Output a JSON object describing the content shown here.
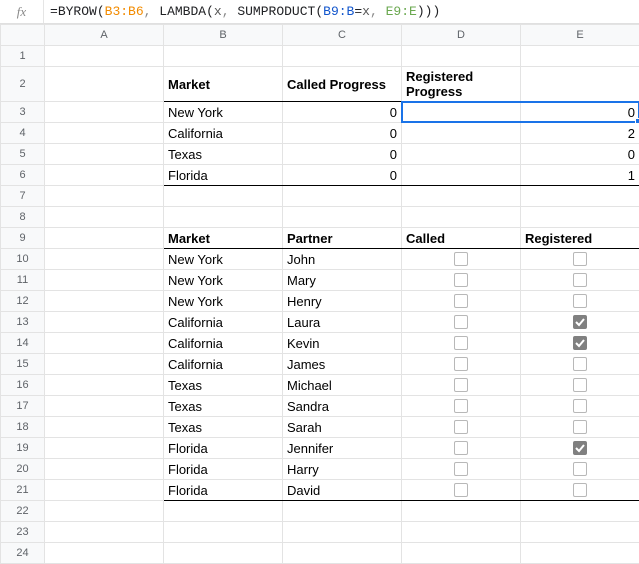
{
  "formula_bar": {
    "fx_label": "fx",
    "eq": "=",
    "fn_byrow": "BYROW",
    "lp": "(",
    "rp": ")",
    "ref_b3b6": "B3:B6",
    "comma": ", ",
    "fn_lambda": "LAMBDA",
    "var_x": "x",
    "fn_sumproduct": "SUMPRODUCT",
    "ref_b9b": "B9:B",
    "eqx": "=",
    "x2": "x",
    "ref_e9e": "E9:E"
  },
  "columns": [
    "A",
    "B",
    "C",
    "D",
    "E"
  ],
  "row_count": 24,
  "summary": {
    "header": {
      "market": "Market",
      "called": "Called Progress",
      "registered": "Registered Progress"
    },
    "rows": [
      {
        "market": "New York",
        "called": 0,
        "registered": 0
      },
      {
        "market": "California",
        "called": 0,
        "registered": 2
      },
      {
        "market": "Texas",
        "called": 0,
        "registered": 0
      },
      {
        "market": "Florida",
        "called": 0,
        "registered": 1
      }
    ]
  },
  "detail": {
    "header": {
      "market": "Market",
      "partner": "Partner",
      "called": "Called",
      "registered": "Registered"
    },
    "rows": [
      {
        "market": "New York",
        "partner": "John",
        "called": false,
        "registered": false
      },
      {
        "market": "New York",
        "partner": "Mary",
        "called": false,
        "registered": false
      },
      {
        "market": "New York",
        "partner": "Henry",
        "called": false,
        "registered": false
      },
      {
        "market": "California",
        "partner": "Laura",
        "called": false,
        "registered": true
      },
      {
        "market": "California",
        "partner": "Kevin",
        "called": false,
        "registered": true
      },
      {
        "market": "California",
        "partner": "James",
        "called": false,
        "registered": false
      },
      {
        "market": "Texas",
        "partner": "Michael",
        "called": false,
        "registered": false
      },
      {
        "market": "Texas",
        "partner": "Sandra",
        "called": false,
        "registered": false
      },
      {
        "market": "Texas",
        "partner": "Sarah",
        "called": false,
        "registered": false
      },
      {
        "market": "Florida",
        "partner": "Jennifer",
        "called": false,
        "registered": true
      },
      {
        "market": "Florida",
        "partner": "Harry",
        "called": false,
        "registered": false
      },
      {
        "market": "Florida",
        "partner": "David",
        "called": false,
        "registered": false
      }
    ]
  },
  "active_cell": {
    "col": "D",
    "row": 3
  },
  "chart_data": {
    "type": "table",
    "tables": [
      {
        "name": "summary",
        "columns": [
          "Market",
          "Called Progress",
          "Registered Progress"
        ],
        "rows": [
          [
            "New York",
            0,
            0
          ],
          [
            "California",
            0,
            2
          ],
          [
            "Texas",
            0,
            0
          ],
          [
            "Florida",
            0,
            1
          ]
        ]
      },
      {
        "name": "detail",
        "columns": [
          "Market",
          "Partner",
          "Called",
          "Registered"
        ],
        "rows": [
          [
            "New York",
            "John",
            false,
            false
          ],
          [
            "New York",
            "Mary",
            false,
            false
          ],
          [
            "New York",
            "Henry",
            false,
            false
          ],
          [
            "California",
            "Laura",
            false,
            true
          ],
          [
            "California",
            "Kevin",
            false,
            true
          ],
          [
            "California",
            "James",
            false,
            false
          ],
          [
            "Texas",
            "Michael",
            false,
            false
          ],
          [
            "Texas",
            "Sandra",
            false,
            false
          ],
          [
            "Texas",
            "Sarah",
            false,
            false
          ],
          [
            "Florida",
            "Jennifer",
            false,
            true
          ],
          [
            "Florida",
            "Harry",
            false,
            false
          ],
          [
            "Florida",
            "David",
            false,
            false
          ]
        ]
      }
    ]
  }
}
